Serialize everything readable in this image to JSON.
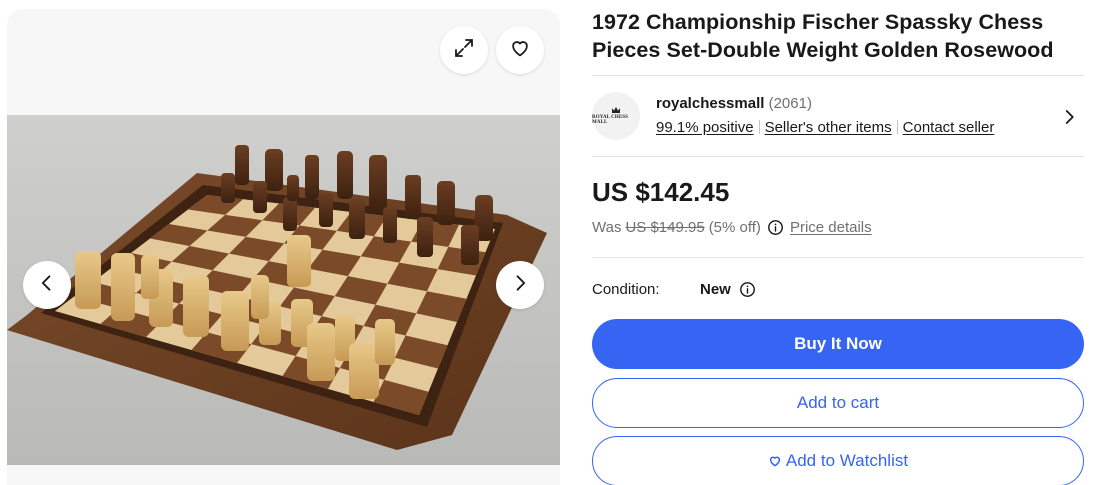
{
  "gallery": {
    "photo_alt": "Chess set on board",
    "icons": {
      "expand": "expand-icon",
      "favorite": "heart-icon",
      "prev": "chevron-left-icon",
      "next": "chevron-right-icon"
    }
  },
  "listing": {
    "title": "1972 Championship Fischer Spassky Chess Pieces Set-Double Weight Golden Rosewood"
  },
  "seller": {
    "logo_text": "ROYAL CHESS MALL",
    "name": "royalchessmall",
    "feedback_count": "(2061)",
    "positive": "99.1% positive",
    "other_items": "Seller's other items",
    "contact": "Contact seller"
  },
  "pricing": {
    "price": "US $142.45",
    "was_label": "Was",
    "was_price": "US $149.95",
    "discount": "(5% off)",
    "details_link": "Price details"
  },
  "condition": {
    "label": "Condition:",
    "value": "New"
  },
  "actions": {
    "buy_now": "Buy It Now",
    "add_to_cart": "Add to cart",
    "add_to_watchlist": "Add to Watchlist"
  },
  "colors": {
    "accent": "#3665f3",
    "text": "#191919",
    "muted": "#707070"
  }
}
